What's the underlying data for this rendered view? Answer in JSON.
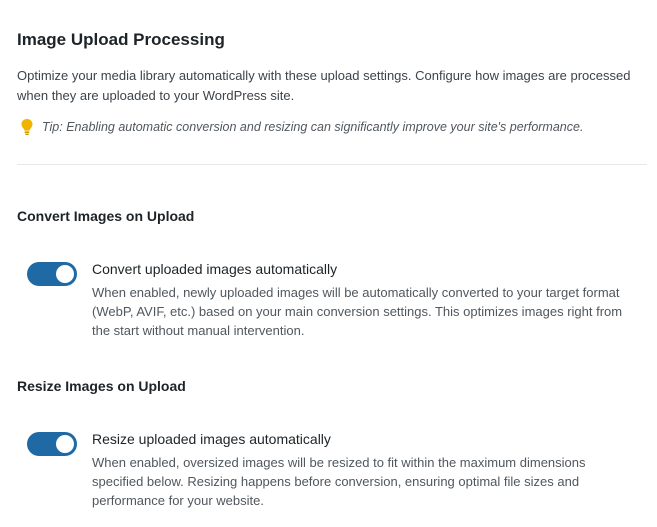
{
  "header": {
    "title": "Image Upload Processing",
    "intro": "Optimize your media library automatically with these upload settings. Configure how images are processed when they are uploaded to your WordPress site.",
    "tip_icon": "lightbulb-icon",
    "tip": "Tip: Enabling automatic conversion and resizing can significantly improve your site's performance."
  },
  "convert_section": {
    "heading": "Convert Images on Upload",
    "toggle_on": true,
    "label": "Convert uploaded images automatically",
    "description": "When enabled, newly uploaded images will be automatically converted to your target format (WebP, AVIF, etc.) based on your main conversion settings. This optimizes images right from the start without manual intervention."
  },
  "resize_section": {
    "heading": "Resize Images on Upload",
    "toggle_on": true,
    "label": "Resize uploaded images automatically",
    "description": "When enabled, oversized images will be resized to fit within the maximum dimensions specified below. Resizing happens before conversion, ensuring optimal file sizes and performance for your website."
  },
  "colors": {
    "toggle_on": "#1f6aa5",
    "tip_icon": "#f0b400",
    "text": "#1d2327",
    "muted": "#50575e"
  }
}
